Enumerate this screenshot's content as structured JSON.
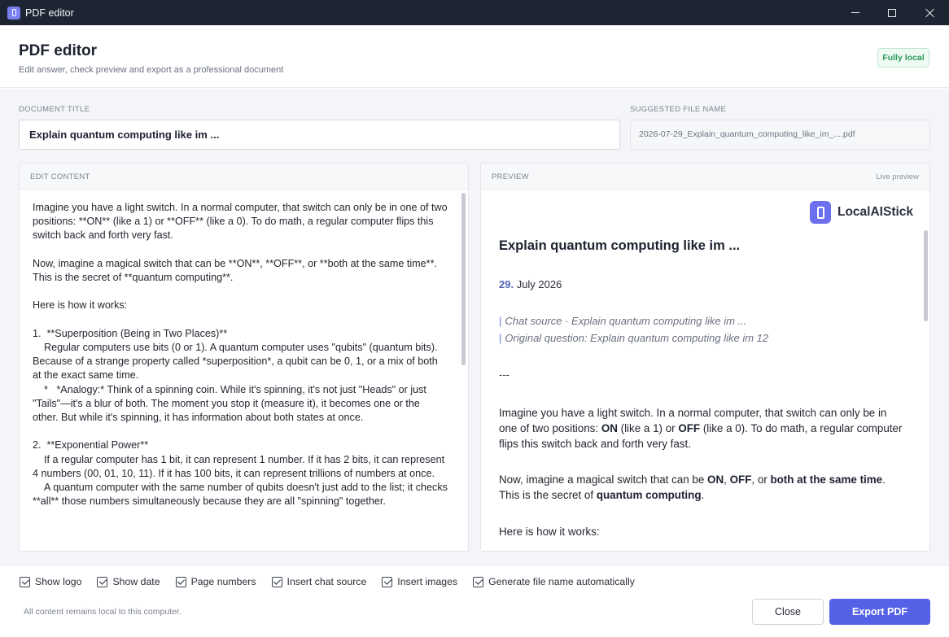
{
  "window": {
    "title": "PDF editor"
  },
  "header": {
    "title": "PDF editor",
    "subtitle": "Edit answer, check preview and export as a professional document",
    "badge": "Fully local"
  },
  "document_title": {
    "label": "DOCUMENT TITLE",
    "value": "Explain quantum computing like im ..."
  },
  "file_name": {
    "label": "SUGGESTED FILE NAME",
    "value": "2026-07-29_Explain_quantum_computing_like_im_....pdf"
  },
  "editor": {
    "label": "EDIT CONTENT",
    "text": "Imagine you have a light switch. In a normal computer, that switch can only be in one of two positions: **ON** (like a 1) or **OFF** (like a 0). To do math, a regular computer flips this switch back and forth very fast.\n\nNow, imagine a magical switch that can be **ON**, **OFF**, or **both at the same time**. This is the secret of **quantum computing**.\n\nHere is how it works:\n\n1.  **Superposition (Being in Two Places)**\n    Regular computers use bits (0 or 1). A quantum computer uses \"qubits\" (quantum bits). Because of a strange property called *superposition*, a qubit can be 0, 1, or a mix of both at the exact same time.\n    *   *Analogy:* Think of a spinning coin. While it's spinning, it's not just \"Heads\" or just \"Tails\"—it's a blur of both. The moment you stop it (measure it), it becomes one or the other. But while it's spinning, it has information about both states at once.\n\n2.  **Exponential Power**\n    If a regular computer has 1 bit, it can represent 1 number. If it has 2 bits, it can represent 4 numbers (00, 01, 10, 11). If it has 100 bits, it can represent trillions of numbers at once.\n    A quantum computer with the same number of qubits doesn't just add to the list; it checks **all** those numbers simultaneously because they are all \"spinning\" together."
  },
  "preview": {
    "label": "PREVIEW",
    "status": "Live preview",
    "brand": "LocalAIStick",
    "title": "Explain quantum computing like im ...",
    "date_day": "29.",
    "date_rest": " July 2026",
    "quote_bar": "|",
    "quote1": "Chat source · Explain quantum computing like im ...",
    "quote2": "Original question: Explain quantum computing like im 12",
    "hr": "---",
    "p1": [
      "Imagine you have a light switch. In a normal computer, that switch can only be in one of two positions: ",
      "ON",
      " (like a 1) or ",
      "OFF",
      " (like a 0). To do math, a regular computer flips this switch back and forth very fast."
    ],
    "p2": [
      "Now, imagine a magical switch that can be ",
      "ON",
      ", ",
      "OFF",
      ", or ",
      "both at the same time",
      ". This is the secret of ",
      "quantum computing",
      "."
    ],
    "p3": "Here is how it works:"
  },
  "options": [
    {
      "label": "Show logo",
      "checked": true
    },
    {
      "label": "Show date",
      "checked": true
    },
    {
      "label": "Page numbers",
      "checked": true
    },
    {
      "label": "Insert chat source",
      "checked": true
    },
    {
      "label": "Insert images",
      "checked": true
    },
    {
      "label": "Generate file name automatically",
      "checked": true
    }
  ],
  "footer": {
    "note": "All content remains local to this computer.",
    "close_label": "Close",
    "export_label": "Export PDF"
  },
  "colors": {
    "accent": "#5561e6",
    "badge_green": "#2a9a5a",
    "titlebar": "#1e2532"
  }
}
